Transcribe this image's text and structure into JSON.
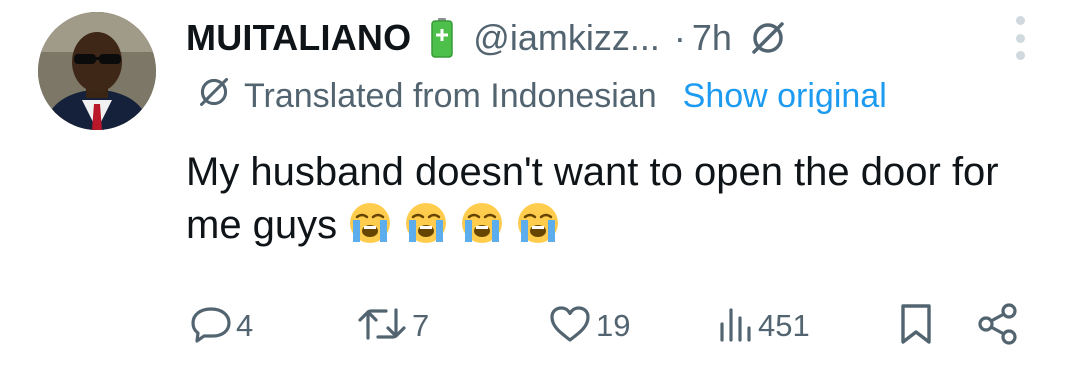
{
  "tweet": {
    "author_name": "MUITALIANO",
    "handle": "@iamkizz...",
    "separator": "·",
    "time": "7h",
    "translation": {
      "label": "Translated from Indonesian",
      "show_original": "Show original"
    },
    "text": "My husband doesn't want to open the door for me guys",
    "emojis": [
      "loudly-crying-face",
      "loudly-crying-face",
      "loudly-crying-face",
      "loudly-crying-face"
    ]
  },
  "actions": {
    "replies": "4",
    "reposts": "7",
    "likes": "19",
    "views": "451"
  },
  "colors": {
    "text": "#0f1419",
    "secondary": "#536471",
    "link": "#1d9bf0",
    "battery_green": "#4cc04a"
  }
}
